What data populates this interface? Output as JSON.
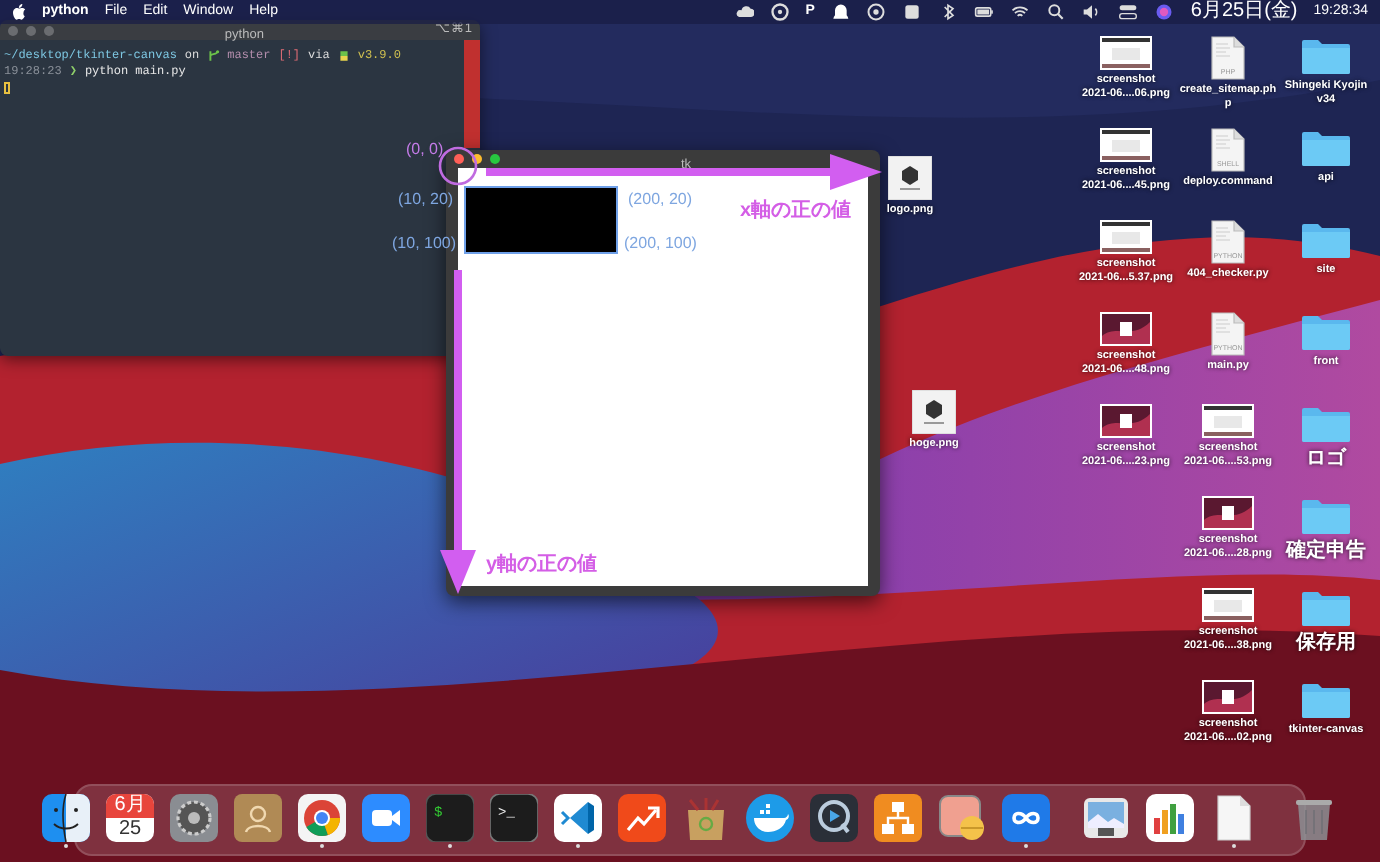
{
  "menu_bar": {
    "app": "python",
    "menus": [
      "File",
      "Edit",
      "Window",
      "Help"
    ],
    "extra": "P",
    "date": "6月25日(金)",
    "time": "19:28:34"
  },
  "terminal": {
    "title": "python",
    "shortcut": "⌥⌘1",
    "prompt": {
      "path": "~/desktop/tkinter-canvas",
      "on": "on",
      "branch": "master",
      "status": "[!]",
      "via": "via",
      "version": "v3.9.0"
    },
    "command_line": {
      "time": "19:28:23",
      "arrow": "❯",
      "command": "python main.py"
    }
  },
  "tk_window": {
    "title": "tk",
    "annotations": [
      {
        "text": "(0, 0)",
        "kind": "origin"
      },
      {
        "text": "(10, 20)",
        "kind": "point"
      },
      {
        "text": "(10, 100)",
        "kind": "point"
      },
      {
        "text": "(200, 20)",
        "kind": "point"
      },
      {
        "text": "(200, 100)",
        "kind": "point"
      }
    ],
    "x_axis_label": "x軸の正の値",
    "y_axis_label": "y軸の正の値"
  },
  "desktop_icons": [
    {
      "label": "screenshot\n2021-06....06.png",
      "kind": "screenshot",
      "dark_thumbnail": false
    },
    {
      "label": "create_sitemap.ph\np",
      "kind": "file",
      "badge": "PHP"
    },
    {
      "label": "Shingeki Kyojin\nv34",
      "kind": "folder"
    },
    {
      "label": "logo.png",
      "kind": "image"
    },
    {
      "label": "screenshot\n2021-06....45.png",
      "kind": "screenshot",
      "dark_thumbnail": false
    },
    {
      "label": "deploy.command",
      "kind": "file",
      "badge": "SHELL"
    },
    {
      "label": "api",
      "kind": "folder"
    },
    {
      "label": "screenshot\n2021-06...5.37.png",
      "kind": "screenshot",
      "dark_thumbnail": false
    },
    {
      "label": "404_checker.py",
      "kind": "file",
      "badge": "PYTHON"
    },
    {
      "label": "site",
      "kind": "folder"
    },
    {
      "label": "screenshot\n2021-06....48.png",
      "kind": "screenshot",
      "dark_thumbnail": true
    },
    {
      "label": "main.py",
      "kind": "file",
      "badge": "PYTHON"
    },
    {
      "label": "front",
      "kind": "folder"
    },
    {
      "label": "hoge.png",
      "kind": "image"
    },
    {
      "label": "screenshot\n2021-06....23.png",
      "kind": "screenshot",
      "dark_thumbnail": true
    },
    {
      "label": "screenshot\n2021-06....53.png",
      "kind": "screenshot",
      "dark_thumbnail": false
    },
    {
      "label": "ロゴ",
      "kind": "folder"
    },
    {
      "label": "screenshot\n2021-06....28.png",
      "kind": "screenshot",
      "dark_thumbnail": true
    },
    {
      "label": "確定申告",
      "kind": "folder"
    },
    {
      "label": "screenshot\n2021-06....38.png",
      "kind": "screenshot",
      "dark_thumbnail": false
    },
    {
      "label": "保存用",
      "kind": "folder"
    },
    {
      "label": "screenshot\n2021-06....02.png",
      "kind": "screenshot",
      "dark_thumbnail": true
    },
    {
      "label": "tkinter-canvas",
      "kind": "folder"
    }
  ],
  "dock": [
    {
      "kind": "finder",
      "running": true
    },
    {
      "kind": "calendar",
      "month": "6月",
      "day": "25",
      "running": false
    },
    {
      "kind": "settings",
      "running": false
    },
    {
      "kind": "contacts",
      "running": false
    },
    {
      "kind": "browser",
      "running": true
    },
    {
      "kind": "video",
      "running": false
    },
    {
      "kind": "terminal-green",
      "glyph": "$",
      "running": true
    },
    {
      "kind": "terminal",
      "glyph": ">_",
      "running": false
    },
    {
      "kind": "editor",
      "running": true
    },
    {
      "kind": "chart-arrow",
      "running": false
    },
    {
      "kind": "archive",
      "running": false
    },
    {
      "kind": "whale",
      "running": false
    },
    {
      "kind": "player",
      "running": false
    },
    {
      "kind": "flowchart",
      "running": false
    },
    {
      "kind": "pill",
      "running": false
    },
    {
      "kind": "infinity",
      "running": true
    },
    {
      "kind": "separator"
    },
    {
      "kind": "photo",
      "running": false
    },
    {
      "kind": "bars",
      "running": false
    },
    {
      "kind": "document",
      "running": true
    },
    {
      "kind": "separator"
    },
    {
      "kind": "trash",
      "running": false
    }
  ]
}
